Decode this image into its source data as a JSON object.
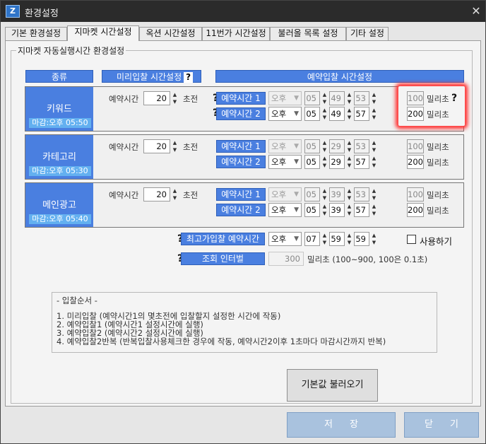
{
  "window": {
    "title": "환경설정",
    "icon": "app-icon",
    "close": "✕"
  },
  "tabs": [
    {
      "label": "기본 환경설정"
    },
    {
      "label": "지마켓 시간설정",
      "active": true
    },
    {
      "label": "옥션 시간설정"
    },
    {
      "label": "11번가 시간설정"
    },
    {
      "label": "불러올 목록 설정"
    },
    {
      "label": "기타 설정"
    }
  ],
  "group_title": "지마켓 자동실행시간 환경설정",
  "headers": {
    "category": "종류",
    "pre_bid": "미리입찰 시간설정",
    "reserve": "예약입찰 시간설정"
  },
  "help_glyph": "?",
  "rows": [
    {
      "name": "키워드",
      "deadline": "마감:오후 05:50",
      "reserve_label": "예약시간",
      "reserve_value": "20",
      "before_label": "초전",
      "r1": {
        "label": "예약시간 1",
        "ampm": "오후",
        "h": "05",
        "m": "49",
        "s": "53",
        "ms": "100",
        "disabled": true
      },
      "r2": {
        "label": "예약시간 2",
        "ampm": "오후",
        "h": "05",
        "m": "49",
        "s": "57",
        "ms": "200",
        "disabled": false
      }
    },
    {
      "name": "카테고리",
      "deadline": "마감:오후 05:30",
      "reserve_label": "예약시간",
      "reserve_value": "20",
      "before_label": "초전",
      "r1": {
        "label": "예약시간 1",
        "ampm": "오후",
        "h": "05",
        "m": "29",
        "s": "53",
        "ms": "100",
        "disabled": true
      },
      "r2": {
        "label": "예약시간 2",
        "ampm": "오후",
        "h": "05",
        "m": "29",
        "s": "57",
        "ms": "200",
        "disabled": false
      }
    },
    {
      "name": "메인광고",
      "deadline": "마감:오후 05:40",
      "reserve_label": "예약시간",
      "reserve_value": "20",
      "before_label": "초전",
      "r1": {
        "label": "예약시간 1",
        "ampm": "오후",
        "h": "05",
        "m": "39",
        "s": "53",
        "ms": "100",
        "disabled": true
      },
      "r2": {
        "label": "예약시간 2",
        "ampm": "오후",
        "h": "05",
        "m": "39",
        "s": "57",
        "ms": "200",
        "disabled": false
      }
    }
  ],
  "ms_unit": "밀리초",
  "max_bid": {
    "label": "최고가입찰 예약시간",
    "ampm": "오후",
    "h": "07",
    "m": "59",
    "s": "59",
    "use_label": "사용하기",
    "checked": false
  },
  "interval": {
    "label": "조회 인터벌",
    "value": "300",
    "hint": "밀리초 (100~900, 100은 0.1초)"
  },
  "info": {
    "title": "- 입찰순서 -",
    "lines": [
      "1. 미리입찰 (예약시간1의 몇초전에 입찰할지 설정한 시간에 작동)",
      "2. 예약입찰1 (예약시간1 설정시간에 실행)",
      "3. 예약입찰2 (예약시간2 설정시간에 실행)",
      "4. 예약입찰2반복 (반복입찰사용체크한 경우에 작동, 예약시간2이후 1초마다 마감시간까지 반복)"
    ]
  },
  "buttons": {
    "default": "기본값 불러오기",
    "save": "저장",
    "close": "닫기"
  },
  "colors": {
    "accent": "#4a7fe0",
    "deadline": "#63b0f0",
    "highlight": "#ff2a2a"
  }
}
